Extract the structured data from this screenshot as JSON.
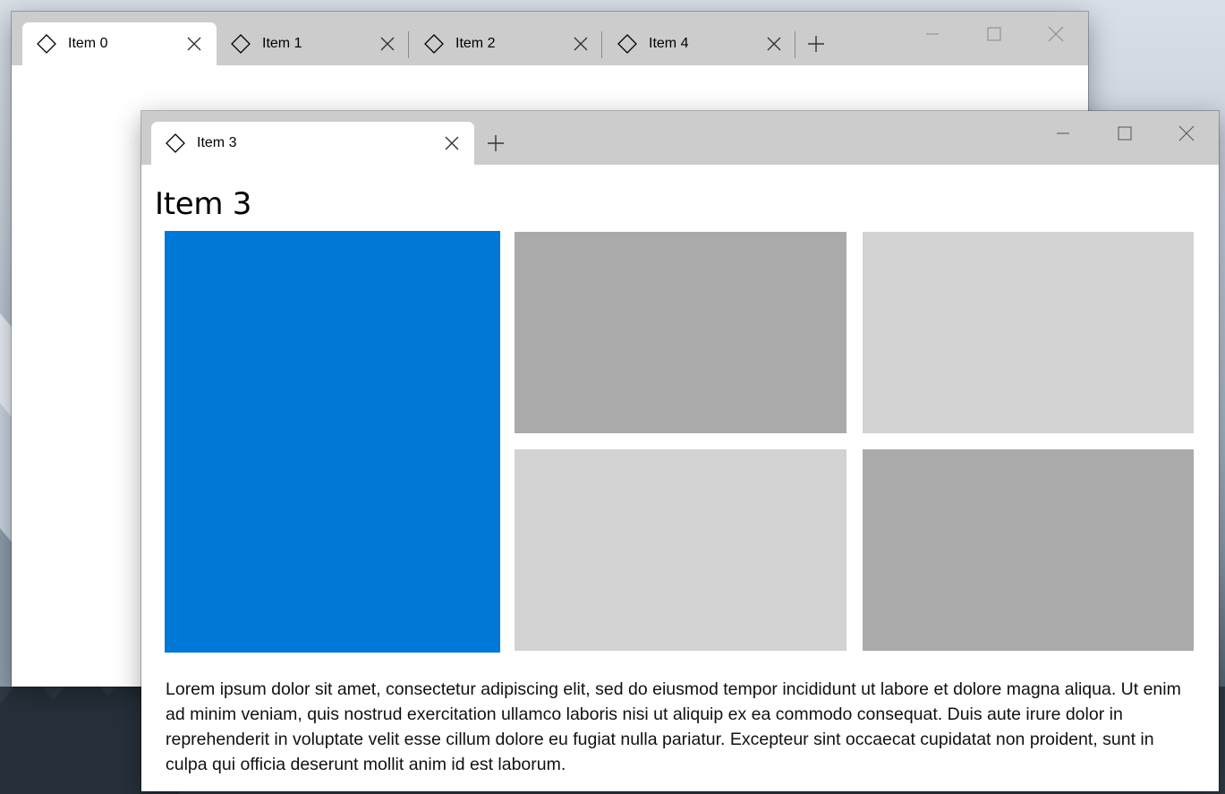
{
  "back_window": {
    "tabs": [
      {
        "label": "Item 0",
        "active": true
      },
      {
        "label": "Item 1",
        "active": false
      },
      {
        "label": "Item 2",
        "active": false
      },
      {
        "label": "Item 4",
        "active": false
      }
    ]
  },
  "front_window": {
    "tabs": [
      {
        "label": "Item 3",
        "active": true
      }
    ],
    "page_title": "Item 3",
    "tiles": [
      {
        "color": "#0078d7"
      },
      {
        "color": "#aaaaaa"
      },
      {
        "color": "#d3d3d3"
      },
      {
        "color": "#d3d3d3"
      },
      {
        "color": "#aaaaaa"
      }
    ],
    "body_text": "Lorem ipsum dolor sit amet, consectetur adipiscing elit, sed do eiusmod tempor incididunt ut labore et dolore magna aliqua. Ut enim ad minim veniam, quis nostrud exercitation ullamco laboris nisi ut aliquip ex ea commodo consequat. Duis aute irure dolor in reprehenderit in voluptate velit esse cillum dolore eu fugiat nulla pariatur. Excepteur sint occaecat cupidatat non proident, sunt in culpa qui officia deserunt mollit anim id est laborum."
  },
  "icons": {
    "tab_icon": "diamond-icon",
    "close": "close-icon",
    "new_tab": "plus-icon",
    "minimize": "minimize-icon",
    "maximize": "maximize-icon",
    "window_close": "window-close-icon"
  },
  "colors": {
    "titlebar": "#cccccc",
    "accent": "#0078d7"
  }
}
